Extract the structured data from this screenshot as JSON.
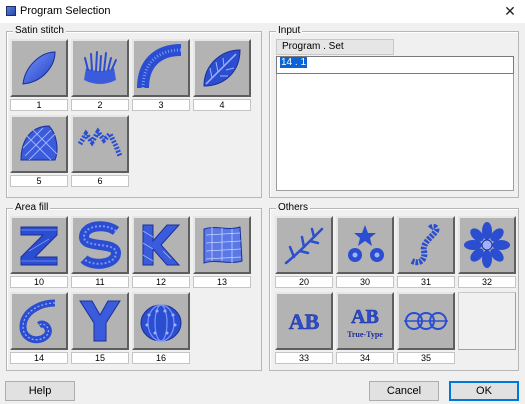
{
  "window": {
    "title": "Program Selection",
    "close_glyph": "✕"
  },
  "groups": {
    "satin": {
      "legend": "Satin stitch",
      "items": [
        {
          "num": "1",
          "icon": "satin-leaf-icon"
        },
        {
          "num": "2",
          "icon": "satin-fringe-icon"
        },
        {
          "num": "3",
          "icon": "satin-arc-icon"
        },
        {
          "num": "4",
          "icon": "satin-leaf-filled-icon"
        },
        {
          "num": "5",
          "icon": "satin-shell-icon"
        },
        {
          "num": "6",
          "icon": "satin-zigzag-icon"
        }
      ]
    },
    "area": {
      "legend": "Area fill",
      "items": [
        {
          "num": "10",
          "icon": "fill-letter-z-icon"
        },
        {
          "num": "11",
          "icon": "fill-letter-s-icon"
        },
        {
          "num": "12",
          "icon": "fill-letter-k-icon"
        },
        {
          "num": "13",
          "icon": "fill-mesh-icon"
        },
        {
          "num": "14",
          "icon": "fill-swirl-icon"
        },
        {
          "num": "15",
          "icon": "fill-letter-y-icon"
        },
        {
          "num": "16",
          "icon": "fill-pumpkin-icon"
        }
      ]
    },
    "others": {
      "legend": "Others",
      "items": [
        {
          "num": "20",
          "icon": "branch-icon"
        },
        {
          "num": "30",
          "icon": "flowers-icon"
        },
        {
          "num": "31",
          "icon": "rope-icon"
        },
        {
          "num": "32",
          "icon": "daisy-icon"
        },
        {
          "num": "33",
          "icon": "text-ab-icon",
          "text": "AB"
        },
        {
          "num": "34",
          "icon": "text-ab-truetype-icon",
          "text": "AB",
          "subtext": "True-Type"
        },
        {
          "num": "35",
          "icon": "circle-chain-icon"
        },
        {
          "num": "",
          "icon": "empty-slot"
        }
      ]
    },
    "input": {
      "legend": "Input",
      "column_header": "Program . Set",
      "value": "14 . 1"
    }
  },
  "buttons": {
    "help": "Help",
    "cancel": "Cancel",
    "ok": "OK"
  },
  "colors": {
    "thread": "#2b4ed0",
    "thread_light": "#7a95ff",
    "thumb_bg": "#b3b3b3",
    "selection": "#0a64d6"
  }
}
